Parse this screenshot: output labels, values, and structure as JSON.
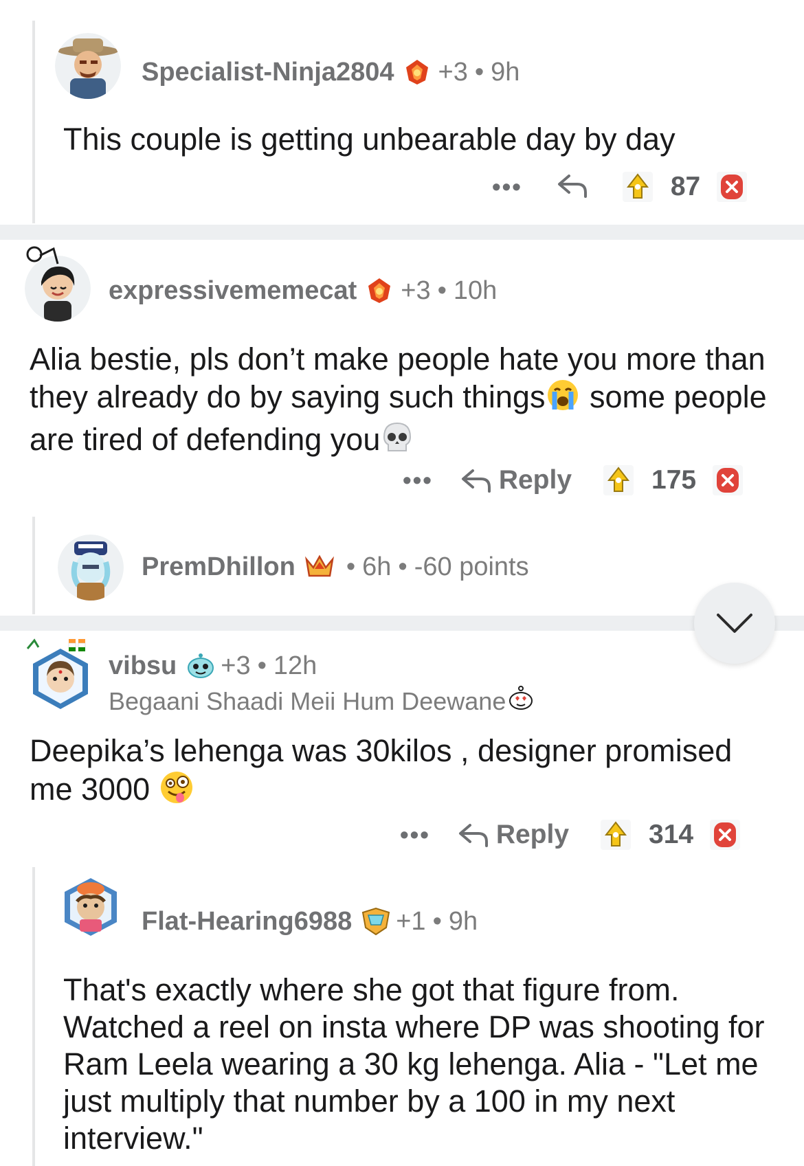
{
  "comments": [
    {
      "username": "Specialist-Ninja2804",
      "karma": "+3",
      "time": "9h",
      "body": "This couple is getting unbearable day by day",
      "actions": {
        "more": "•••",
        "score": "87"
      }
    },
    {
      "username": "expressivememecat",
      "karma": "+3",
      "time": "10h",
      "body_1": "Alia bestie, pls don’t make people hate you more than they already do by saying such things",
      "body_2": " some people are tired of defending you",
      "actions": {
        "more": "•••",
        "reply": "Reply",
        "score": "175"
      }
    },
    {
      "username": "PremDhillon",
      "time": "6h",
      "points": "-60 points"
    },
    {
      "username": "vibsu",
      "karma": "+3",
      "time": "12h",
      "flair": "Begaani Shaadi Meii Hum Deewane",
      "body": "Deepika’s lehenga was 30kilos , designer  promised me 3000",
      "actions": {
        "more": "•••",
        "reply": "Reply",
        "score": "314"
      }
    },
    {
      "username": "Flat-Hearing6988",
      "karma": "+1",
      "time": "9h",
      "body": "That's exactly where she got that figure from. Watched a reel on insta where DP was shooting for Ram Leela wearing a 30 kg lehenga. Alia - \"Let me just multiply that number by a 100 in my next interview.\""
    }
  ],
  "separator": "•",
  "icons": {
    "badge": "flame-gem-icon",
    "upvote": "upvote-award-icon",
    "downvote": "downvote-icon",
    "reply": "reply-arrow-icon",
    "scroll": "chevron-down-icon"
  },
  "colors": {
    "badge_red": "#e0421b",
    "upvote_gold": "#f5c518",
    "downvote_red": "#e0433a"
  }
}
